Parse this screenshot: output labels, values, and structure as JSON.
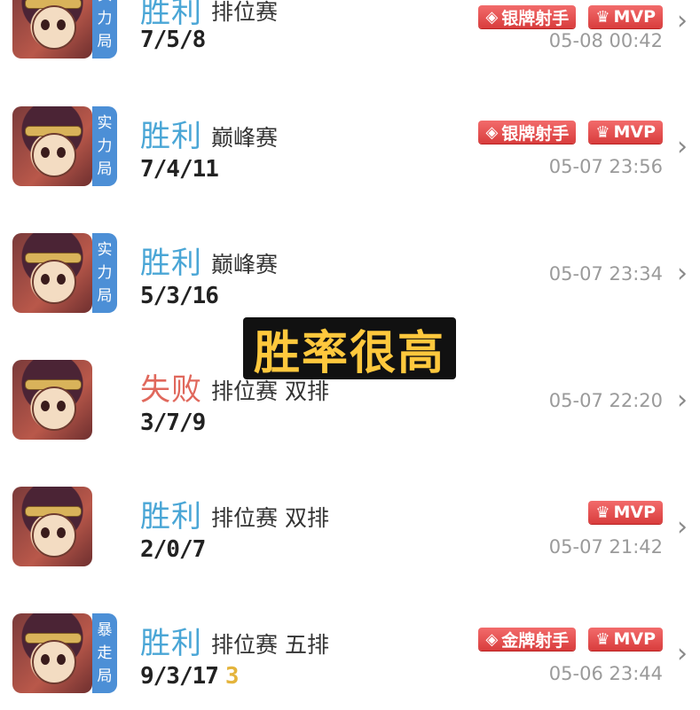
{
  "overlay_caption": "胜率很高",
  "matches": [
    {
      "result": "胜利",
      "mode": "排位赛",
      "party": "",
      "kda": "7/5/8",
      "time": "05-08 00:42",
      "tag": [
        "实",
        "力",
        "局"
      ],
      "badges": [
        {
          "text": "银牌射手",
          "icon": "diamond-icon"
        },
        {
          "text": "MVP",
          "icon": "trophy-icon"
        }
      ]
    },
    {
      "result": "胜利",
      "mode": "巅峰赛",
      "party": "",
      "kda": "7/4/11",
      "time": "05-07 23:56",
      "tag": [
        "实",
        "力",
        "局"
      ],
      "badges": [
        {
          "text": "银牌射手",
          "icon": "diamond-icon"
        },
        {
          "text": "MVP",
          "icon": "trophy-icon"
        }
      ]
    },
    {
      "result": "胜利",
      "mode": "巅峰赛",
      "party": "",
      "kda": "5/3/16",
      "time": "05-07 23:34",
      "tag": [
        "实",
        "力",
        "局"
      ],
      "badges": []
    },
    {
      "result": "失败",
      "mode": "排位赛",
      "party": "双排",
      "kda": "3/7/9",
      "time": "05-07 22:20",
      "tag": [],
      "badges": []
    },
    {
      "result": "胜利",
      "mode": "排位赛",
      "party": "双排",
      "kda": "2/0/7",
      "time": "05-07 21:42",
      "tag": [],
      "badges": [
        {
          "text": "MVP",
          "icon": "trophy-icon"
        }
      ]
    },
    {
      "result": "胜利",
      "mode": "排位赛",
      "party": "五排",
      "kda": "9/3/17",
      "streak": "3",
      "time": "05-06 23:44",
      "tag": [
        "暴",
        "走",
        "局"
      ],
      "badges": [
        {
          "text": "金牌射手",
          "icon": "diamond-icon"
        },
        {
          "text": "MVP",
          "icon": "trophy-icon"
        }
      ]
    }
  ],
  "icons": {
    "chevron": "chevron-right-icon"
  },
  "colors": {
    "win": "#4aa6d6",
    "lose": "#e0685c",
    "tag": "#4c8fd6",
    "badge": "#e04848",
    "caption_text": "#ffc83d",
    "caption_bg": "#111111"
  }
}
